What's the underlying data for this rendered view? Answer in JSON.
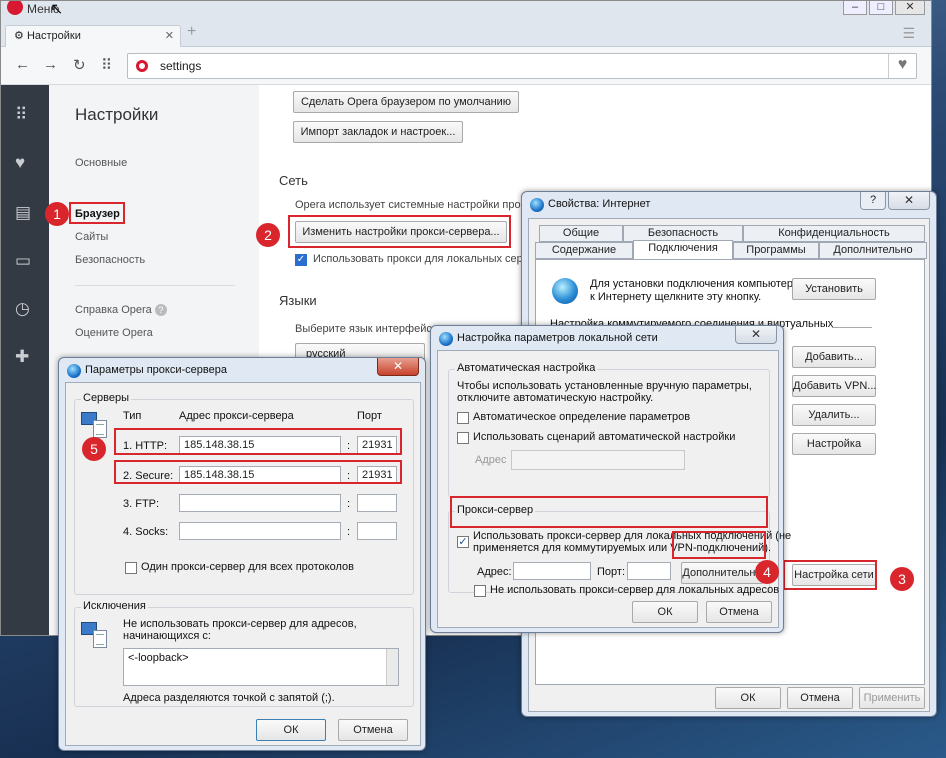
{
  "opera": {
    "menu_label": "Меню",
    "tab_title": "Настройки",
    "url": "settings",
    "sidebar_title": "Настройки",
    "nav_items": [
      "Основные",
      "Браузер",
      "Сайты",
      "Безопасность"
    ],
    "nav_links": [
      "Справка Opera",
      "Оцените Opera"
    ],
    "default_browser_btn": "Сделать Opera браузером по умолчанию",
    "import_btn": "Импорт закладок и настроек...",
    "network_section": "Сеть",
    "network_desc": "Opera использует системные настройки прокс",
    "proxy_btn": "Изменить настройки прокси-сервера...",
    "proxy_local_chk": "Использовать прокси для локальных серве",
    "languages_section": "Языки",
    "languages_desc": "Выберите язык интерфейса",
    "language_value": "русский"
  },
  "inet": {
    "title": "Свойства: Интернет",
    "tabs_row1": [
      "Общие",
      "Безопасность",
      "Конфиденциальность"
    ],
    "tabs_row2": [
      "Содержание",
      "Подключения",
      "Программы",
      "Дополнительно"
    ],
    "setup_text1": "Для установки подключения компьютера",
    "setup_text2": "к Интернету щелкните эту кнопку.",
    "setup_btn": "Установить",
    "dialup_text": "Настройка коммутируемого соединения и виртуальных",
    "add_btn": "Добавить...",
    "add_vpn_btn": "Добавить VPN...",
    "remove_btn": "Удалить...",
    "settings_btn": "Настройка",
    "lan_btn": "Настройка сети",
    "ok": "ОК",
    "cancel": "Отмена",
    "apply": "Применить"
  },
  "lan": {
    "title": "Настройка параметров локальной сети",
    "auto_group": "Автоматическая настройка",
    "auto_desc1": "Чтобы использовать установленные вручную параметры,",
    "auto_desc2": "отключите автоматическую настройку.",
    "auto_detect": "Автоматическое определение параметров",
    "auto_script": "Использовать сценарий автоматической настройки",
    "address_label": "Адрес",
    "proxy_group": "Прокси-сервер",
    "use_proxy1": "Использовать прокси-сервер для локальных подключений (не",
    "use_proxy2": "применяется для коммутируемых или VPN-подключений).",
    "addr_label": "Адрес:",
    "port_label": "Порт:",
    "advanced_btn": "Дополнительно",
    "bypass_local": "Не использовать прокси-сервер для локальных адресов",
    "ok": "ОК",
    "cancel": "Отмена"
  },
  "proxy": {
    "title": "Параметры прокси-сервера",
    "servers_group": "Серверы",
    "col_type": "Тип",
    "col_address": "Адрес прокси-сервера",
    "col_port": "Порт",
    "rows": [
      {
        "type": "1. HTTP:",
        "address": "185.148.38.15",
        "port": "21931"
      },
      {
        "type": "2. Secure:",
        "address": "185.148.38.15",
        "port": "21931"
      },
      {
        "type": "3. FTP:",
        "address": "",
        "port": ""
      },
      {
        "type": "4. Socks:",
        "address": "",
        "port": ""
      }
    ],
    "colon": ":",
    "same_proxy": "Один прокси-сервер для всех протоколов",
    "exceptions_group": "Исключения",
    "exc_desc1": "Не использовать прокси-сервер для адресов,",
    "exc_desc2": "начинающихся с:",
    "exc_value": "<-loopback>",
    "exc_hint": "Адреса разделяются точкой с запятой (;).",
    "ok": "ОК",
    "cancel": "Отмена"
  },
  "badges": [
    "1",
    "2",
    "3",
    "4",
    "5"
  ],
  "colors": {
    "highlight": "#d9262c",
    "opera_red": "#d81830",
    "sidebar": "#333a44"
  }
}
